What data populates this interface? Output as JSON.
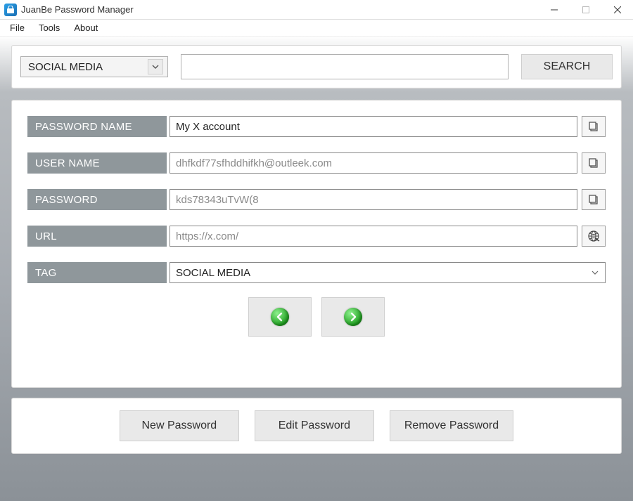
{
  "window": {
    "title": "JuanBe Password Manager"
  },
  "menu": {
    "file": "File",
    "tools": "Tools",
    "about": "About"
  },
  "search": {
    "category_selected": "SOCIAL MEDIA",
    "query": "",
    "button_label": "SEARCH"
  },
  "fields": {
    "password_name": {
      "label": "PASSWORD NAME",
      "value": "My X account"
    },
    "user_name": {
      "label": "USER NAME",
      "value": "dhfkdf77sfhddhifkh@outleek.com"
    },
    "password": {
      "label": "PASSWORD",
      "value": "kds78343uTvW(8"
    },
    "url": {
      "label": "URL",
      "value": "https://x.com/"
    },
    "tag": {
      "label": "TAG",
      "value": "SOCIAL MEDIA"
    }
  },
  "actions": {
    "new": "New Password",
    "edit": "Edit Password",
    "remove": "Remove Password"
  },
  "icons": {
    "copy": "copy-icon",
    "globe": "globe-icon",
    "prev": "arrow-left-icon",
    "next": "arrow-right-icon"
  },
  "colors": {
    "label_bg": "#8f979b",
    "button_bg": "#e9e9e9",
    "nav_arrow_green": "#1fa01f"
  }
}
